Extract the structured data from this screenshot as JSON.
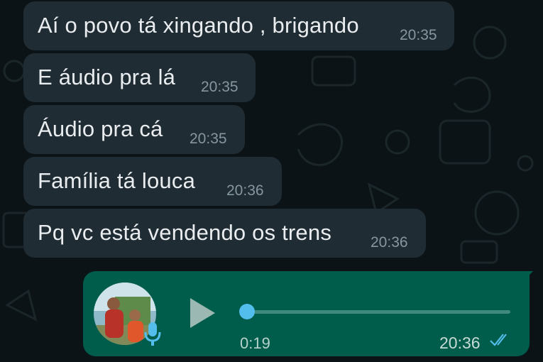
{
  "messages": [
    {
      "text": "Aí o povo tá xingando , brigando",
      "time": "20:35"
    },
    {
      "text": "E áudio pra lá",
      "time": "20:35"
    },
    {
      "text": "Áudio pra cá",
      "time": "20:35"
    },
    {
      "text": "Família tá louca",
      "time": "20:36"
    },
    {
      "text": "Pq vc está vendendo os trens",
      "time": "20:36"
    }
  ],
  "voice_message": {
    "duration": "0:19",
    "time": "20:36",
    "progress": 0,
    "status": "read"
  },
  "colors": {
    "background": "#0c1317",
    "incoming_bubble": "#202c33",
    "outgoing_bubble": "#005c4b",
    "read_ticks": "#53bdeb"
  },
  "icons": [
    "play-icon",
    "microphone-icon",
    "double-check-icon"
  ]
}
